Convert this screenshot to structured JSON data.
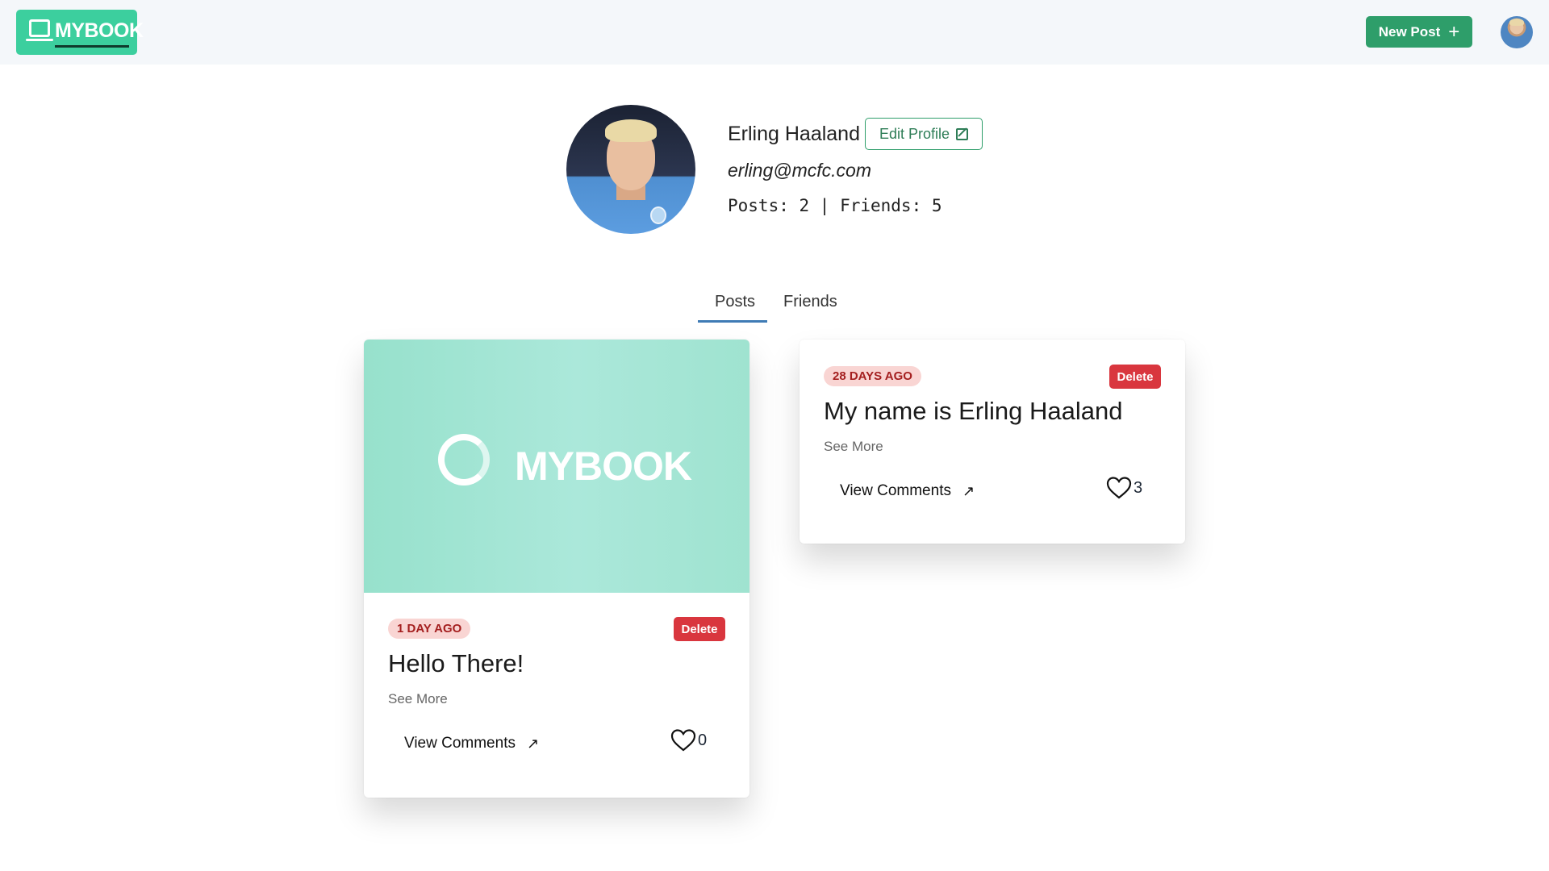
{
  "header": {
    "logo_text": "MYBOOK",
    "new_post_label": "New Post",
    "new_post_icon": "plus-icon",
    "accent_color": "#3ccf9e",
    "button_color": "#2e9e6a"
  },
  "profile": {
    "name": "Erling Haaland",
    "edit_label": "Edit Profile",
    "edit_icon": "edit-icon",
    "email": "erling@mcfc.com",
    "stats": "Posts: 2 | Friends: 5"
  },
  "tabs": [
    {
      "label": "Posts",
      "active": true
    },
    {
      "label": "Friends",
      "active": false
    }
  ],
  "posts": [
    {
      "image_text": "MYBOOK",
      "time": "1 DAY AGO",
      "delete_label": "Delete",
      "title": "Hello There!",
      "see_more": "See More",
      "view_comments": "View Comments",
      "likes": "0"
    },
    {
      "time": "28 DAYS AGO",
      "delete_label": "Delete",
      "title": "My name is Erling Haaland",
      "see_more": "See More",
      "view_comments": "View Comments",
      "likes": "3"
    }
  ]
}
